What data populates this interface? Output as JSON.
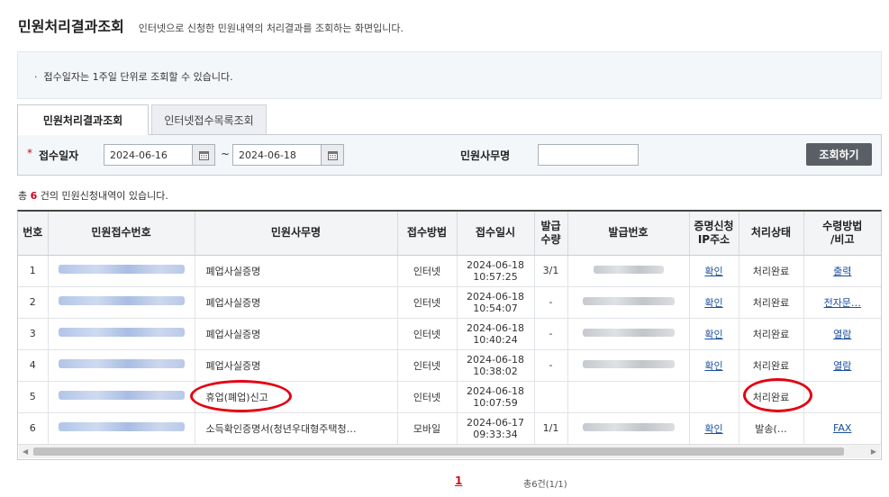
{
  "header": {
    "title": "민원처리결과조회",
    "description": "인터넷으로 신청한 민원내역의 처리결과를 조회하는 화면입니다."
  },
  "notice": "접수일자는 1주일 단위로 조회할 수 있습니다.",
  "tabs": [
    {
      "label": "민원처리결과조회",
      "active": true
    },
    {
      "label": "인터넷접수목록조회",
      "active": false
    }
  ],
  "search": {
    "required_mark": "*",
    "date_label": "접수일자",
    "date_from": "2024-06-16",
    "date_sep": "~",
    "date_to": "2024-06-18",
    "name_label": "민원사무명",
    "name_value": "",
    "button": "조회하기"
  },
  "result_count": {
    "prefix": "총 ",
    "count": "6",
    "suffix": " 건의 민원신청내역이 있습니다."
  },
  "table": {
    "headers": {
      "no": "번호",
      "receipt_no": "민원접수번호",
      "name": "민원사무명",
      "method": "접수방법",
      "date": "접수일시",
      "qty_1": "발급",
      "qty_2": "수량",
      "issue_no": "발급번호",
      "ip_1": "증명신청",
      "ip_2": "IP주소",
      "status": "처리상태",
      "recv_1": "수령방법",
      "recv_2": "/비고"
    },
    "rows": [
      {
        "no": "1",
        "name": "폐업사실증명",
        "method": "인터넷",
        "date": "2024-06-18",
        "time": "10:57:25",
        "qty": "3/1",
        "ip": "확인",
        "status": "처리완료",
        "recv": "출력"
      },
      {
        "no": "2",
        "name": "폐업사실증명",
        "method": "인터넷",
        "date": "2024-06-18",
        "time": "10:54:07",
        "qty": "-",
        "ip": "확인",
        "status": "처리완료",
        "recv": "전자문…"
      },
      {
        "no": "3",
        "name": "폐업사실증명",
        "method": "인터넷",
        "date": "2024-06-18",
        "time": "10:40:24",
        "qty": "-",
        "ip": "확인",
        "status": "처리완료",
        "recv": "열람"
      },
      {
        "no": "4",
        "name": "폐업사실증명",
        "method": "인터넷",
        "date": "2024-06-18",
        "time": "10:38:02",
        "qty": "-",
        "ip": "확인",
        "status": "처리완료",
        "recv": "열람"
      },
      {
        "no": "5",
        "name": "휴업(폐업)신고",
        "method": "인터넷",
        "date": "2024-06-18",
        "time": "10:07:59",
        "qty": "",
        "ip": "",
        "status": "처리완료",
        "recv": ""
      },
      {
        "no": "6",
        "name": "소득확인증명서(청년우대형주택청…",
        "method": "모바일",
        "date": "2024-06-17",
        "time": "09:33:34",
        "qty": "1/1",
        "ip": "확인",
        "status": "발송(…",
        "recv": "FAX"
      }
    ]
  },
  "pagination": {
    "current": "1",
    "total_text": "총6건(1/1)"
  },
  "colors": {
    "accent_red": "#d0021b",
    "link": "#1a4f9c",
    "annotation": "#e30012"
  }
}
